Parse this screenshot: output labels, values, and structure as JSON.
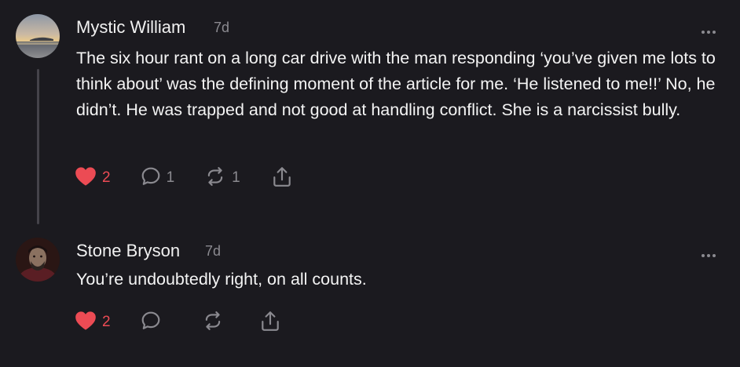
{
  "comments": [
    {
      "author": "Mystic William",
      "age": "7d",
      "text": "The six hour rant on a long car drive with the man responding ‘you’ve given me lots to think about’ was the defining moment of the article for me. ‘He listened to me!!’ No, he didn’t. He was trapped and not good at handling conflict. She is a narcissist bully.",
      "likes": "2",
      "replies": "1",
      "restacks": "1",
      "liked": true
    },
    {
      "author": "Stone Bryson",
      "age": "7d",
      "text": "You’re undoubtedly right, on all counts.",
      "likes": "2",
      "liked": true
    }
  ],
  "icons": {
    "like": "heart-icon",
    "reply": "comment-bubble-icon",
    "restack": "restack-arrows-icon",
    "share": "share-icon",
    "more": "more-dots-icon"
  },
  "colors": {
    "background": "#1b1a1f",
    "liked": "#ec4b54",
    "muted": "#8b8a90",
    "text": "#f4f4f4"
  }
}
